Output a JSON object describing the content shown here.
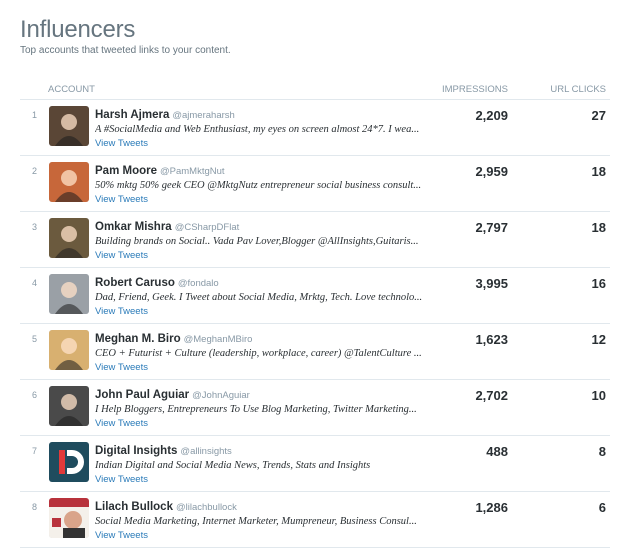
{
  "page": {
    "title": "Influencers",
    "subtitle": "Top accounts that tweeted links to your content."
  },
  "table": {
    "headers": {
      "account": "ACCOUNT",
      "impressions": "IMPRESSIONS",
      "url_clicks": "URL CLICKS"
    },
    "view_label": "View Tweets",
    "rows": [
      {
        "rank": "1",
        "name": "Harsh Ajmera",
        "handle": "@ajmeraharsh",
        "bio": "A #SocialMedia and Web Enthusiast, my eyes on screen almost 24*7. I wea...",
        "impressions": "2,209",
        "clicks": "27",
        "avatar_color": "#5a4636"
      },
      {
        "rank": "2",
        "name": "Pam Moore",
        "handle": "@PamMktgNut",
        "bio": "50% mktg 50% geek CEO @MktgNutz entrepreneur social business consult...",
        "impressions": "2,959",
        "clicks": "18",
        "avatar_color": "#c7673a"
      },
      {
        "rank": "3",
        "name": "Omkar Mishra",
        "handle": "@CSharpDFlat",
        "bio": "Building brands on Social.. Vada Pav Lover,Blogger @AllInsights,Guitaris...",
        "impressions": "2,797",
        "clicks": "18",
        "avatar_color": "#6b5a3e"
      },
      {
        "rank": "4",
        "name": "Robert Caruso",
        "handle": "@fondalo",
        "bio": "Dad, Friend, Geek. I Tweet about Social Media, Mrktg, Tech. Love technolo...",
        "impressions": "3,995",
        "clicks": "16",
        "avatar_color": "#9aa0a6"
      },
      {
        "rank": "5",
        "name": "Meghan M. Biro",
        "handle": "@MeghanMBiro",
        "bio": "CEO + Futurist + Culture (leadership, workplace, career) @TalentCulture ...",
        "impressions": "1,623",
        "clicks": "12",
        "avatar_color": "#d8b070"
      },
      {
        "rank": "6",
        "name": "John Paul Aguiar",
        "handle": "@JohnAguiar",
        "bio": "I Help Bloggers, Entrepreneurs To Use Blog Marketing, Twitter Marketing...",
        "impressions": "2,702",
        "clicks": "10",
        "avatar_color": "#4a4a4a"
      },
      {
        "rank": "7",
        "name": "Digital Insights",
        "handle": "@allinsights",
        "bio": "Indian Digital and Social Media News, Trends, Stats and Insights",
        "impressions": "488",
        "clicks": "8",
        "avatar_color": "#1f4c5e"
      },
      {
        "rank": "8",
        "name": "Lilach Bullock",
        "handle": "@lilachbullock",
        "bio": "Social Media Marketing, Internet Marketer, Mumpreneur, Business Consul...",
        "impressions": "1,286",
        "clicks": "6",
        "avatar_color": "#b8323c"
      }
    ]
  },
  "colors": {
    "link": "#2b7bb9",
    "muted": "#8899a6",
    "title": "#66757f",
    "divider": "#e1e8ed"
  }
}
